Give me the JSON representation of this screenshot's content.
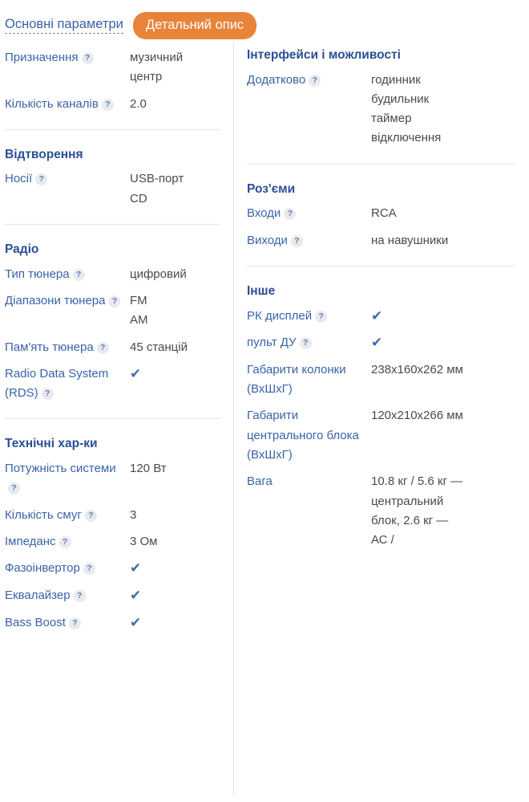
{
  "tabs": [
    {
      "label": "Основні параметри",
      "active": false
    },
    {
      "label": "Детальний опис",
      "active": true
    }
  ],
  "colors": {
    "accent_orange": "#e8833a",
    "link_blue": "#3a63a8",
    "heading_blue": "#2b4f96",
    "check_blue": "#3f6cae",
    "value_gray": "#4a4a4a",
    "divider_gray": "#e5e5e8"
  },
  "help_icon": "?",
  "check_icon": "✔",
  "left_column": [
    {
      "title": null,
      "rows": [
        {
          "label": "Призначення",
          "help": true,
          "value": "музичний\nцентр"
        },
        {
          "label": "Кількість каналів",
          "help": true,
          "value": "2.0"
        }
      ]
    },
    {
      "title": "Відтворення",
      "rows": [
        {
          "label": "Носії",
          "help": true,
          "value": "USB-порт\nCD"
        }
      ]
    },
    {
      "title": "Радіо",
      "rows": [
        {
          "label": "Тип тюнера",
          "help": true,
          "value": "цифровий"
        },
        {
          "label": "Діапазони тюнера",
          "help": true,
          "value": "FM\nAM"
        },
        {
          "label": "Пам'ять тюнера",
          "help": true,
          "value": "45 станцій"
        },
        {
          "label": "Radio Data System (RDS)",
          "help": true,
          "check": true
        }
      ]
    },
    {
      "title": "Технічні хар-ки",
      "rows": [
        {
          "label": "Потужність системи",
          "help": true,
          "value": "120 Вт"
        },
        {
          "label": "Кількість смуг",
          "help": true,
          "value": "3"
        },
        {
          "label": "Імпеданс",
          "help": true,
          "value": "3 Ом"
        },
        {
          "label": "Фазоінвертор",
          "help": true,
          "check": true
        },
        {
          "label": "Еквалайзер",
          "help": true,
          "check": true
        },
        {
          "label": "Bass Boost",
          "help": true,
          "check": true
        }
      ]
    }
  ],
  "right_column": [
    {
      "title": "Інтерфейси і можливості",
      "rows": [
        {
          "label": "Додатково",
          "help": true,
          "value": "годинник\nбудильник\nтаймер\nвідключення"
        }
      ]
    },
    {
      "title": "Роз'єми",
      "rows": [
        {
          "label": "Входи",
          "help": true,
          "value": "RCA"
        },
        {
          "label": "Виходи",
          "help": true,
          "value": "на навушники"
        }
      ]
    },
    {
      "title": "Інше",
      "rows": [
        {
          "label": "РК дисплей",
          "help": true,
          "check": true
        },
        {
          "label": "пульт ДУ",
          "help": true,
          "check": true
        },
        {
          "label": "Габарити колонки (ВхШхГ)",
          "help": false,
          "value": "238x160x262 мм"
        },
        {
          "label": "Габарити центрального блока (ВхШхГ)",
          "help": false,
          "value": "120x210x266 мм"
        },
        {
          "label": "Вага",
          "help": false,
          "value": "10.8 кг / 5.6 кг —\nцентральний\nблок, 2.6 кг —\nАС /"
        }
      ]
    }
  ]
}
